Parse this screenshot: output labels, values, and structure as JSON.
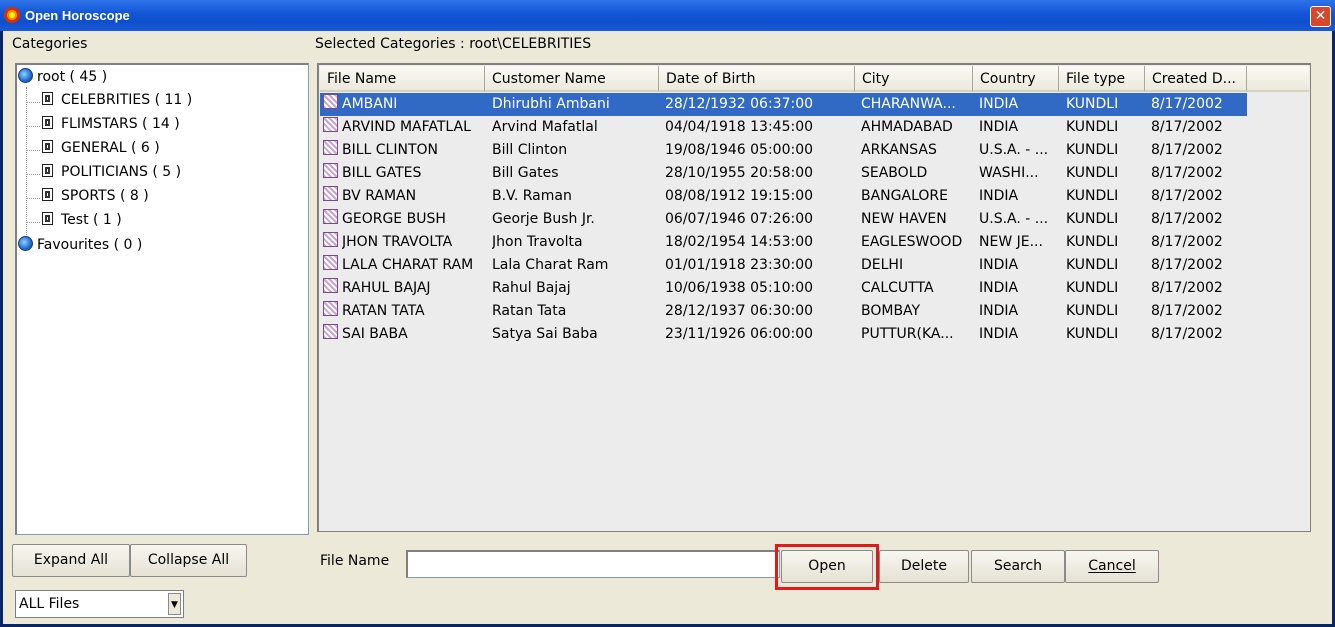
{
  "window": {
    "title": "Open Horoscope"
  },
  "categories_label": "Categories",
  "selected_categories": "Selected Categories : root\\CELEBRITIES",
  "tree": {
    "root": "root ( 45 )",
    "children": [
      "CELEBRITIES ( 11 )",
      "FLIMSTARS ( 14 )",
      "GENERAL ( 6 )",
      "POLITICIANS ( 5 )",
      "SPORTS ( 8 )",
      "Test ( 1 )"
    ],
    "favourites": "Favourites ( 0 )"
  },
  "table": {
    "columns": [
      "File Name",
      "Customer Name",
      "Date of Birth",
      "City",
      "Country",
      "File type",
      "Created D..."
    ],
    "rows": [
      [
        "AMBANI",
        "Dhirubhi Ambani",
        "28/12/1932 06:37:00",
        "CHARANWA...",
        "INDIA",
        "KUNDLI",
        "8/17/2002"
      ],
      [
        "ARVIND MAFATLAL",
        "Arvind Mafatlal",
        "04/04/1918 13:45:00",
        "AHMADABAD",
        "INDIA",
        "KUNDLI",
        "8/17/2002"
      ],
      [
        "BILL CLINTON",
        "Bill Clinton",
        "19/08/1946 05:00:00",
        "ARKANSAS",
        "U.S.A. - ...",
        "KUNDLI",
        "8/17/2002"
      ],
      [
        "BILL GATES",
        "Bill Gates",
        "28/10/1955 20:58:00",
        "SEABOLD",
        "WASHI...",
        "KUNDLI",
        "8/17/2002"
      ],
      [
        "BV RAMAN",
        "B.V. Raman",
        "08/08/1912 19:15:00",
        "BANGALORE",
        "INDIA",
        "KUNDLI",
        "8/17/2002"
      ],
      [
        "GEORGE BUSH",
        "Georje Bush Jr.",
        "06/07/1946 07:26:00",
        "NEW HAVEN",
        "U.S.A. - ...",
        "KUNDLI",
        "8/17/2002"
      ],
      [
        "JHON TRAVOLTA",
        "Jhon Travolta",
        "18/02/1954 14:53:00",
        "EAGLESWOOD",
        "NEW JE...",
        "KUNDLI",
        "8/17/2002"
      ],
      [
        "LALA CHARAT RAM",
        "Lala Charat Ram",
        "01/01/1918 23:30:00",
        "DELHI",
        "INDIA",
        "KUNDLI",
        "8/17/2002"
      ],
      [
        "RAHUL BAJAJ",
        "Rahul Bajaj",
        "10/06/1938 05:10:00",
        "CALCUTTA",
        "INDIA",
        "KUNDLI",
        "8/17/2002"
      ],
      [
        "RATAN TATA",
        "Ratan Tata",
        "28/12/1937 06:30:00",
        "BOMBAY",
        "INDIA",
        "KUNDLI",
        "8/17/2002"
      ],
      [
        "SAI BABA",
        "Satya Sai Baba",
        "23/11/1926 06:00:00",
        "PUTTUR(KA...",
        "INDIA",
        "KUNDLI",
        "8/17/2002"
      ]
    ],
    "selected_row": 0
  },
  "buttons": {
    "expand_all": "Expand All",
    "collapse_all": "Collapse All",
    "open": "Open",
    "delete": "Delete",
    "search": "Search",
    "cancel": "Cancel"
  },
  "file_name_label": "File Name",
  "file_name_value": "",
  "file_type_select": "ALL Files",
  "colors": {
    "titlebar": "#1155d6",
    "selection": "#316ac5",
    "highlight": "#e01b1b",
    "dialog_bg": "#ece9d8"
  }
}
